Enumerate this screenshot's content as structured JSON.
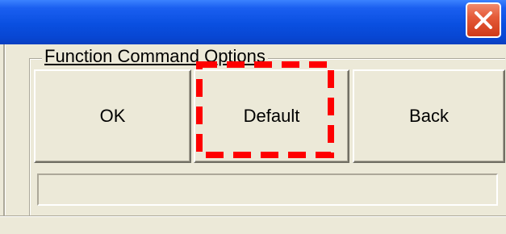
{
  "window": {
    "title": "",
    "close_icon": "close-icon"
  },
  "group": {
    "label": "Function Command Options"
  },
  "buttons": {
    "ok_label": "OK",
    "default_label": "Default",
    "back_label": "Back"
  },
  "status": {
    "value": ""
  },
  "annotation": {
    "highlight_color": "#ff0000",
    "target": "Default"
  },
  "colors": {
    "titlebar": "#0a4fe0",
    "close_button": "#e55b39",
    "face": "#ece9d8"
  }
}
